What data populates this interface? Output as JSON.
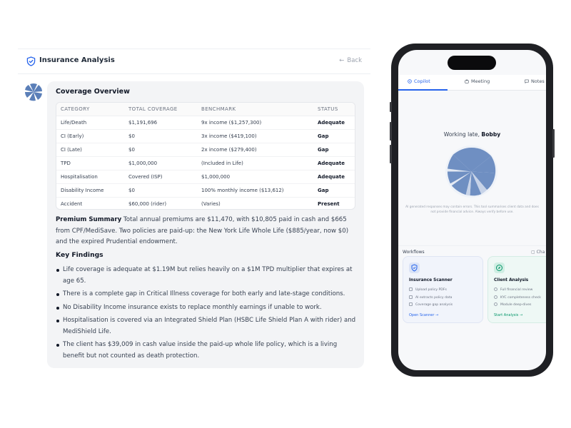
{
  "header": {
    "title": "Insurance Analysis",
    "back_label": "Back"
  },
  "coverage": {
    "title": "Coverage Overview",
    "columns": [
      "CATEGORY",
      "TOTAL COVERAGE",
      "BENCHMARK",
      "STATUS"
    ],
    "rows": [
      [
        "Life/Death",
        "$1,191,696",
        "9x income ($1,257,300)",
        "Adequate"
      ],
      [
        "CI (Early)",
        "$0",
        "3x income ($419,100)",
        "Gap"
      ],
      [
        "CI (Late)",
        "$0",
        "2x income ($279,400)",
        "Gap"
      ],
      [
        "TPD",
        "$1,000,000",
        "(Included in Life)",
        "Adequate"
      ],
      [
        "Hospitalisation",
        "Covered (ISP)",
        "$1,000,000",
        "Adequate"
      ],
      [
        "Disability Income",
        "$0",
        "100% monthly income ($13,612)",
        "Gap"
      ],
      [
        "Accident",
        "$60,000 (rider)",
        "(Varies)",
        "Present"
      ]
    ]
  },
  "premium": {
    "label": "Premium Summary",
    "text": "Total annual premiums are $11,470, with $10,805 paid in cash and $665 from CPF/MediSave. Two policies are paid-up: the New York Life Whole Life ($885/year, now $0) and the expired Prudential endowment."
  },
  "findings": {
    "title": "Key Findings",
    "items": [
      "Life coverage is adequate at $1.19M but relies heavily on a $1M TPD multiplier that expires at age 65.",
      "There is a complete gap in Critical Illness coverage for both early and late-stage conditions.",
      "No Disability Income insurance exists to replace monthly earnings if unable to work.",
      "Hospitalisation is covered via an Integrated Shield Plan (HSBC Life Shield Plan A with rider) and MediShield Life.",
      "The client has $39,009 in cash value inside the paid-up whole life policy, which is a living benefit but not counted as death protection."
    ]
  },
  "phone": {
    "tabs": [
      "Copilot",
      "Meeting",
      "Notes"
    ],
    "active_tab": "Copilot",
    "greeting_prefix": "Working late,",
    "greeting_name": "Bobby",
    "disclaimer": "AI generated responses may contain errors. This tool summarises client data and does not provide financial advice. Always verify before use.",
    "workflows_label": "Workflows",
    "chat_label": "Cha",
    "cards": [
      {
        "title": "Insurance Scanner",
        "items": [
          "Upload policy PDFs",
          "AI extracts policy data",
          "Coverage gap analysis"
        ],
        "link": "Open Scanner →",
        "accent": "#2563eb"
      },
      {
        "title": "Client Analysis",
        "items": [
          "Full financial review",
          "KYC completeness check",
          "Module deep-dives"
        ],
        "link": "Start Analysis →",
        "accent": "#059669"
      }
    ]
  },
  "colors": {
    "accent": "#2563eb",
    "orb": "#6f8fc2",
    "success": "#059669"
  }
}
